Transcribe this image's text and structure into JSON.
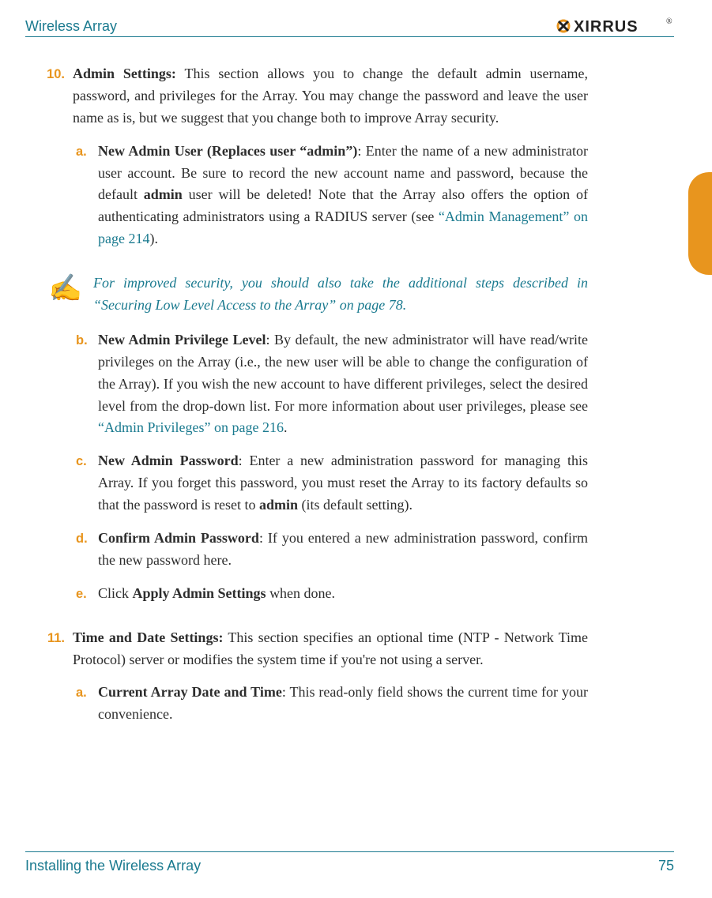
{
  "header": {
    "title": "Wireless Array",
    "logo_text": "XIRRUS"
  },
  "side_tab": {},
  "sections": [
    {
      "number": "10.",
      "title": "Admin Settings:",
      "intro": " This section allows you to change the default admin username, password, and privileges for the Array. You may change the password and leave the user name as is, but we suggest that you change both to improve Array security.",
      "sub": [
        {
          "letter": "a.",
          "title": "New Admin User (Replaces user “admin”)",
          "body_pre": ": Enter the name of a new administrator user account. Be sure to record the new account name and password, because the default ",
          "bold_inline": "admin",
          "body_mid": " user will be deleted! Note that the Array also offers the option of authenticating administrators using a RADIUS server (see ",
          "link": "“Admin Management” on page 214",
          "body_post": ")."
        },
        {
          "letter": "b.",
          "title": "New Admin Privilege Level",
          "body_pre": ": By default, the new administrator will have read/write privileges on the Array (i.e., the new user will be able to change the configuration of the Array). If you wish the new account to have different privileges, select the desired level from the drop-down list. For more information about user privileges, please see ",
          "link": "“Admin Privileges” on page 216",
          "body_post": "."
        },
        {
          "letter": "c.",
          "title": "New Admin Password",
          "body_pre": ": Enter a new administration password for managing this Array. If you forget this password, you must reset the Array to its factory defaults so that the password is reset to ",
          "bold_inline": "admin",
          "body_post": " (its default setting)."
        },
        {
          "letter": "d.",
          "title": "Confirm Admin Password",
          "body_pre": ": If you entered a new administration password, confirm the new password here."
        },
        {
          "letter": "e.",
          "body_pre": "Click ",
          "bold_inline": "Apply Admin Settings",
          "body_post": " when done."
        }
      ],
      "note": {
        "text": "For improved security, you should also take the additional steps described in “Securing Low Level Access to the Array” on page 78."
      }
    },
    {
      "number": "11.",
      "title": "Time and Date Settings:",
      "intro": " This section specifies an optional time (NTP - Network Time Protocol) server or modifies the system time if you're not using a server.",
      "sub": [
        {
          "letter": "a.",
          "title": "Current Array Date and Time",
          "body_pre": ": This read-only field shows the current time for your convenience."
        }
      ]
    }
  ],
  "footer": {
    "left": "Installing the Wireless Array",
    "right": "75"
  }
}
